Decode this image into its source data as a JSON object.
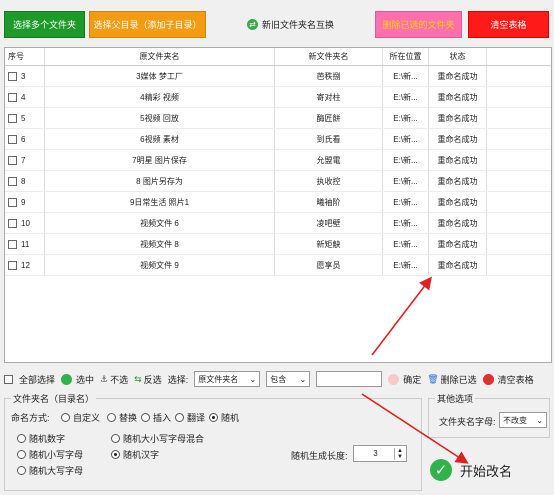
{
  "toolbar": {
    "add_folders": "选择多个文件夹",
    "add_parent": "选择父目录（添加子目录）",
    "swap_names": "新旧文件夹名互换",
    "delete_selected": "删除已选的文件夹",
    "clear_table": "清空表格"
  },
  "table": {
    "headers": [
      "序号",
      "原文件夹名",
      "新文件夹名",
      "所在位置",
      "状态"
    ],
    "rows": [
      {
        "no": "3",
        "old": "3媒体  梦工厂",
        "new": "芭秩捌",
        "loc": "E:\\新...",
        "status": "重命名成功"
      },
      {
        "no": "4",
        "old": "4精彩  视频",
        "new": "寄对柱",
        "loc": "E:\\新...",
        "status": "重命名成功"
      },
      {
        "no": "5",
        "old": "5视频  回放",
        "new": "酶匠餅",
        "loc": "E:\\新...",
        "status": "重命名成功"
      },
      {
        "no": "6",
        "old": "6视频  素材",
        "new": "到氏看",
        "loc": "E:\\新...",
        "status": "重命名成功"
      },
      {
        "no": "7",
        "old": "7明星  图片保存",
        "new": "允盟電",
        "loc": "E:\\新...",
        "status": "重命名成功"
      },
      {
        "no": "8",
        "old": "8  图片另存为",
        "new": "执收控",
        "loc": "E:\\新...",
        "status": "重命名成功"
      },
      {
        "no": "9",
        "old": "9日常生活  照片1",
        "new": "曦袖阶",
        "loc": "E:\\新...",
        "status": "重命名成功"
      },
      {
        "no": "10",
        "old": "视频文件 6",
        "new": "凌吧壁",
        "loc": "E:\\新...",
        "status": "重命名成功"
      },
      {
        "no": "11",
        "old": "视频文件 8",
        "new": "新矩觖",
        "loc": "E:\\新...",
        "status": "重命名成功"
      },
      {
        "no": "12",
        "old": "视频文件 9",
        "new": "愿享员",
        "loc": "E:\\新...",
        "status": "重命名成功"
      }
    ]
  },
  "selection_bar": {
    "select_all": "全部选择",
    "check": "选中",
    "uncheck": "不选",
    "invert": "反选",
    "select_label": "选择:",
    "field_value": "原文件夹名",
    "match_value": "包含",
    "text_value": "",
    "confirm": "确定",
    "delete_selected": "删除已选",
    "clear_table": "清空表格"
  },
  "options": {
    "group_title": "文件夹名（目录名）",
    "mode_label": "命名方式:",
    "modes": [
      "自定义",
      "替换",
      "插入",
      "翻译",
      "随机"
    ],
    "random_types": [
      "随机数字",
      "随机大小写字母混合",
      "随机小写字母",
      "随机汉字",
      "随机大写字母"
    ],
    "length_label": "随机生成长度:",
    "length_value": "3"
  },
  "other": {
    "group_title": "其他选项",
    "case_label": "文件夹名字母:",
    "case_value": "不改变"
  },
  "start_label": "开始改名",
  "colors": {
    "green": "#1e9a2a",
    "orange": "#f39c12",
    "pink": "#ff6fae",
    "red": "#ff1a1a",
    "arrow": "#e02020"
  }
}
